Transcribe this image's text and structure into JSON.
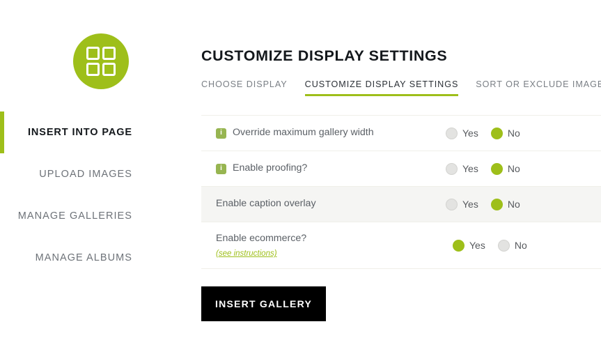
{
  "theme": {
    "accent_green": "#9ebf1a",
    "info_icon_green": "#97b551",
    "button_black": "#000000",
    "stripe_gray": "#f5f5f3"
  },
  "sidebar": {
    "logo_icon": "grid-2x2-icon",
    "items": [
      {
        "label": "INSERT INTO PAGE",
        "active": true
      },
      {
        "label": "UPLOAD IMAGES",
        "active": false
      },
      {
        "label": "MANAGE GALLERIES",
        "active": false
      },
      {
        "label": "MANAGE ALBUMS",
        "active": false
      }
    ]
  },
  "main": {
    "title": "CUSTOMIZE DISPLAY SETTINGS",
    "tabs": [
      {
        "label": "CHOOSE DISPLAY",
        "active": false
      },
      {
        "label": "CUSTOMIZE DISPLAY SETTINGS",
        "active": true
      },
      {
        "label": "SORT OR EXCLUDE IMAGES",
        "active": false
      }
    ],
    "settings": [
      {
        "label": "Override maximum gallery width",
        "has_info": true,
        "info_icon": "info-icon",
        "striped": false,
        "link": null,
        "yes_label": "Yes",
        "no_label": "No",
        "selected": "No"
      },
      {
        "label": "Enable proofing?",
        "has_info": true,
        "info_icon": "info-icon",
        "striped": false,
        "link": null,
        "yes_label": "Yes",
        "no_label": "No",
        "selected": "No"
      },
      {
        "label": "Enable caption overlay",
        "has_info": false,
        "info_icon": null,
        "striped": true,
        "link": null,
        "yes_label": "Yes",
        "no_label": "No",
        "selected": "No"
      },
      {
        "label": "Enable ecommerce?",
        "has_info": false,
        "info_icon": null,
        "striped": false,
        "link": "(see instructions)",
        "yes_label": "Yes",
        "no_label": "No",
        "selected": "Yes"
      }
    ],
    "insert_button_label": "INSERT GALLERY"
  }
}
